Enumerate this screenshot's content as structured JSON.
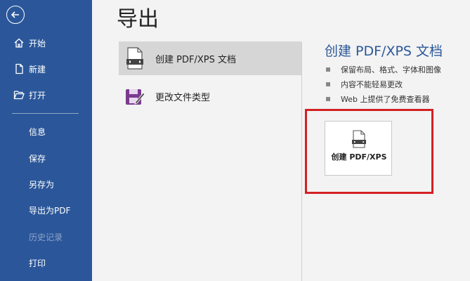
{
  "sidebar": {
    "items": [
      {
        "label": "开始",
        "icon": "home-icon"
      },
      {
        "label": "新建",
        "icon": "new-document-icon"
      },
      {
        "label": "打开",
        "icon": "folder-open-icon"
      },
      {
        "label": "信息"
      },
      {
        "label": "保存"
      },
      {
        "label": "另存为"
      },
      {
        "label": "导出为PDF"
      },
      {
        "label": "历史记录",
        "disabled": true
      },
      {
        "label": "打印"
      }
    ]
  },
  "main": {
    "title": "导出",
    "options": [
      {
        "label": "创建 PDF/XPS 文档",
        "icon": "pdf-document-icon",
        "selected": true
      },
      {
        "label": "更改文件类型",
        "icon": "change-file-type-icon",
        "selected": false
      }
    ]
  },
  "detail": {
    "title": "创建 PDF/XPS 文档",
    "bullets": [
      "保留布局、格式、字体和图像",
      "内容不能轻易更改",
      "Web 上提供了免费查看器"
    ],
    "create_button_label": "创建 PDF/XPS"
  },
  "colors": {
    "sidebar": "#2b579a",
    "accent": "#2b579a",
    "highlight": "#d32023"
  }
}
